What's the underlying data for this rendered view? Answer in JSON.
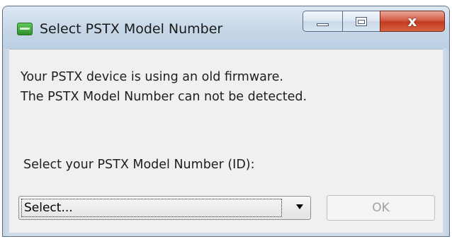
{
  "window": {
    "title": "Select PSTX Model Number",
    "icon": "app-icon",
    "caption_buttons": {
      "minimize": "minimize-icon",
      "maximize": "maximize-icon",
      "close_glyph": "x"
    }
  },
  "message": {
    "line1": "Your PSTX device is using an old firmware.",
    "line2": "The PSTX Model Number can not be detected."
  },
  "select": {
    "label": "Select your PSTX Model Number (ID):",
    "value": "Select..."
  },
  "buttons": {
    "ok_label": "OK",
    "ok_enabled": false
  },
  "colors": {
    "close_button": "#c33a20",
    "frame": "#cfdbe8",
    "client": "#f0f0f0"
  }
}
